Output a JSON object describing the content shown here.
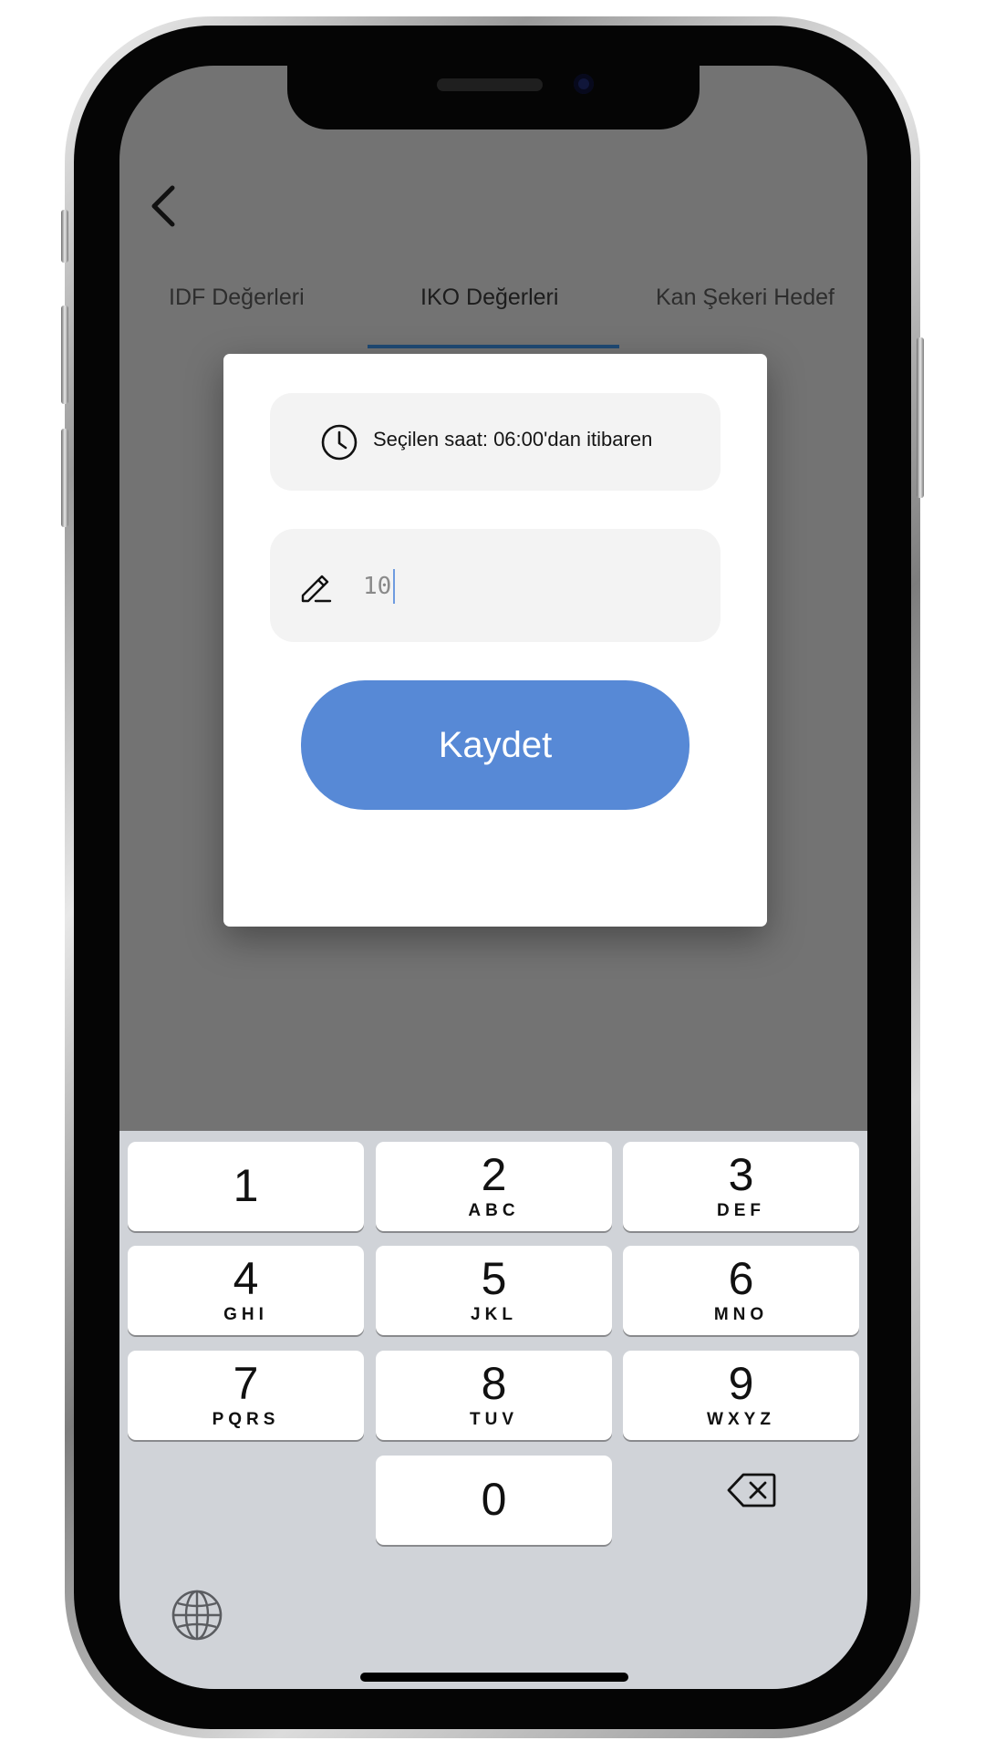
{
  "nav": {
    "back_icon": "chevron-left-icon"
  },
  "tabs": [
    {
      "label": "IDF Değerleri",
      "active": false
    },
    {
      "label": "IKO Değerleri",
      "active": true
    },
    {
      "label": "Kan Şekeri Hedef",
      "active": false
    }
  ],
  "dialog": {
    "time_icon": "clock-icon",
    "time_text": "Seçilen saat: 06:00'dan itibaren",
    "value_icon": "pencil-icon",
    "value": "10",
    "save_label": "Kaydet"
  },
  "keypad": {
    "keys": [
      {
        "digit": "1",
        "letters": ""
      },
      {
        "digit": "2",
        "letters": "ABC"
      },
      {
        "digit": "3",
        "letters": "DEF"
      },
      {
        "digit": "4",
        "letters": "GHI"
      },
      {
        "digit": "5",
        "letters": "JKL"
      },
      {
        "digit": "6",
        "letters": "MNO"
      },
      {
        "digit": "7",
        "letters": "PQRS"
      },
      {
        "digit": "8",
        "letters": "TUV"
      },
      {
        "digit": "9",
        "letters": "WXYZ"
      },
      {
        "digit": "0",
        "letters": ""
      }
    ],
    "backspace_icon": "backspace-icon",
    "globe_icon": "globe-icon"
  },
  "colors": {
    "accent": "#5789d6",
    "tab_indicator": "#1f4a74",
    "overlay": "#737373",
    "keyboard_bg": "#d0d3d8"
  }
}
